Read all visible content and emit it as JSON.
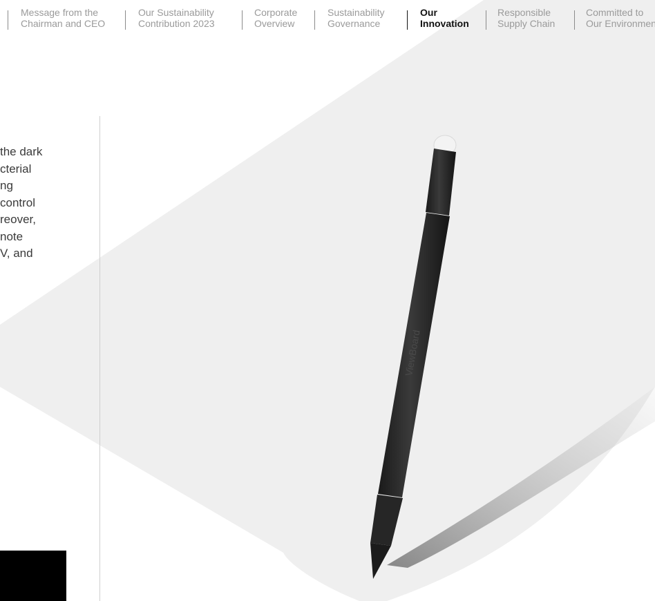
{
  "nav": {
    "items": [
      {
        "line1": "Message from the",
        "line2": "Chairman and CEO",
        "active": false
      },
      {
        "line1": "Our Sustainability",
        "line2": "Contribution 2023",
        "active": false
      },
      {
        "line1": "Corporate",
        "line2": "Overview",
        "active": false
      },
      {
        "line1": "Sustainability",
        "line2": "Governance",
        "active": false
      },
      {
        "line1": "Our",
        "line2": "Innovation",
        "active": true
      },
      {
        "line1": "Responsible",
        "line2": "Supply Chain",
        "active": false
      },
      {
        "line1": "Committed to",
        "line2": "Our Environment",
        "active": false
      }
    ]
  },
  "body": {
    "lines": [
      "the dark",
      "cterial",
      "ng",
      "control",
      "reover,",
      "note",
      "V, and"
    ]
  },
  "pen": {
    "brand_text": "ViewBoard"
  },
  "colors": {
    "background_shape": "#efefef",
    "active_nav": "#111111",
    "inactive_nav": "#9a9a9a",
    "pen_body": "#2b2b2b"
  }
}
